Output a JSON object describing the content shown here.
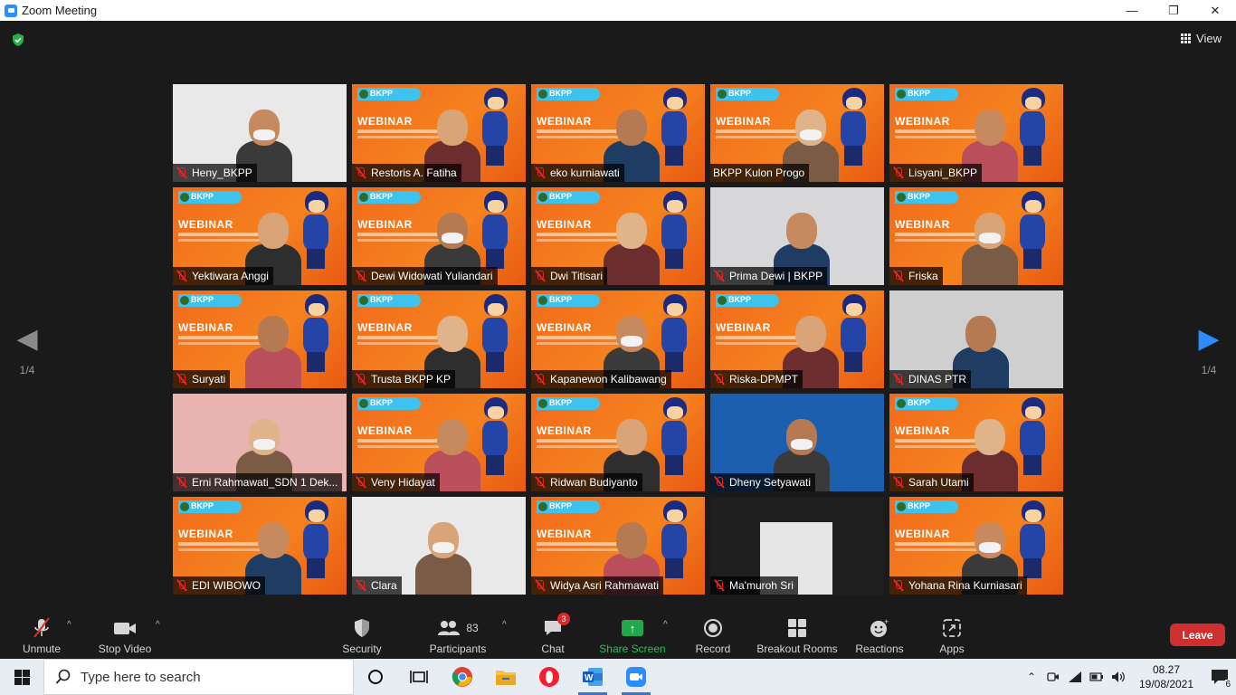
{
  "window": {
    "title": "Zoom Meeting",
    "controls": [
      "—",
      "❐",
      "✕"
    ]
  },
  "top": {
    "view_label": "View"
  },
  "pager": {
    "left": "1/4",
    "right": "1/4"
  },
  "tiles": [
    {
      "name": "Heny_BKPP",
      "bg": "room",
      "mic_off": true
    },
    {
      "name": "Restoris A. Fatiha",
      "bg": "banner",
      "mic_off": true
    },
    {
      "name": "eko kurniawati",
      "bg": "banner",
      "mic_off": true
    },
    {
      "name": "BKPP Kulon Progo",
      "bg": "banner",
      "mic_off": false,
      "active": true
    },
    {
      "name": "Lisyani_BKPP",
      "bg": "banner",
      "mic_off": true
    },
    {
      "name": "Yektiwara Anggi",
      "bg": "banner",
      "mic_off": true
    },
    {
      "name": "Dewi Widowati Yuliandari",
      "bg": "banner",
      "mic_off": true
    },
    {
      "name": "Dwi Titisari",
      "bg": "banner",
      "mic_off": true
    },
    {
      "name": "Prima Dewi | BKPP",
      "bg": "room2",
      "mic_off": true
    },
    {
      "name": "Friska",
      "bg": "banner",
      "mic_off": true
    },
    {
      "name": "Suryati",
      "bg": "banner",
      "mic_off": true
    },
    {
      "name": "Trusta BKPP KP",
      "bg": "banner",
      "mic_off": true
    },
    {
      "name": "Kapanewon Kalibawang",
      "bg": "banner",
      "mic_off": true
    },
    {
      "name": "Riska-DPMPT",
      "bg": "banner",
      "mic_off": true
    },
    {
      "name": "DINAS PTR",
      "bg": "grey",
      "mic_off": true
    },
    {
      "name": "Erni Rahmawati_SDN 1 Dek...",
      "bg": "pink",
      "mic_off": true
    },
    {
      "name": "Veny Hidayat",
      "bg": "banner",
      "mic_off": true
    },
    {
      "name": "Ridwan Budiyanto",
      "bg": "banner",
      "mic_off": true
    },
    {
      "name": "Dheny Setyawati",
      "bg": "blue",
      "mic_off": true
    },
    {
      "name": "Sarah Utami",
      "bg": "banner",
      "mic_off": true
    },
    {
      "name": "EDI WIBOWO",
      "bg": "banner",
      "mic_off": true
    },
    {
      "name": "Clara",
      "bg": "room",
      "mic_off": true
    },
    {
      "name": "Widya Asri Rahmawati",
      "bg": "banner",
      "mic_off": true
    },
    {
      "name": "Ma'muroh Sri",
      "bg": "dark",
      "mic_off": true
    },
    {
      "name": "Yohana Rina Kurniasari",
      "bg": "banner",
      "mic_off": true
    }
  ],
  "banner": {
    "brand": "BKPP",
    "headline": "WEBINAR"
  },
  "toolbar": {
    "unmute": "Unmute",
    "stop_video": "Stop Video",
    "security": "Security",
    "participants": "Participants",
    "participants_count": "83",
    "chat": "Chat",
    "chat_badge": "3",
    "share_screen": "Share Screen",
    "record": "Record",
    "breakout": "Breakout Rooms",
    "reactions": "Reactions",
    "apps": "Apps",
    "leave": "Leave"
  },
  "taskbar": {
    "search_placeholder": "Type here to search",
    "time": "08.27",
    "date": "19/08/2021",
    "notifications": "6"
  },
  "colors": {
    "accent": "#2d8cff",
    "leave": "#d02f2f",
    "share": "#23a74d",
    "active_border": "#d8e56b"
  }
}
